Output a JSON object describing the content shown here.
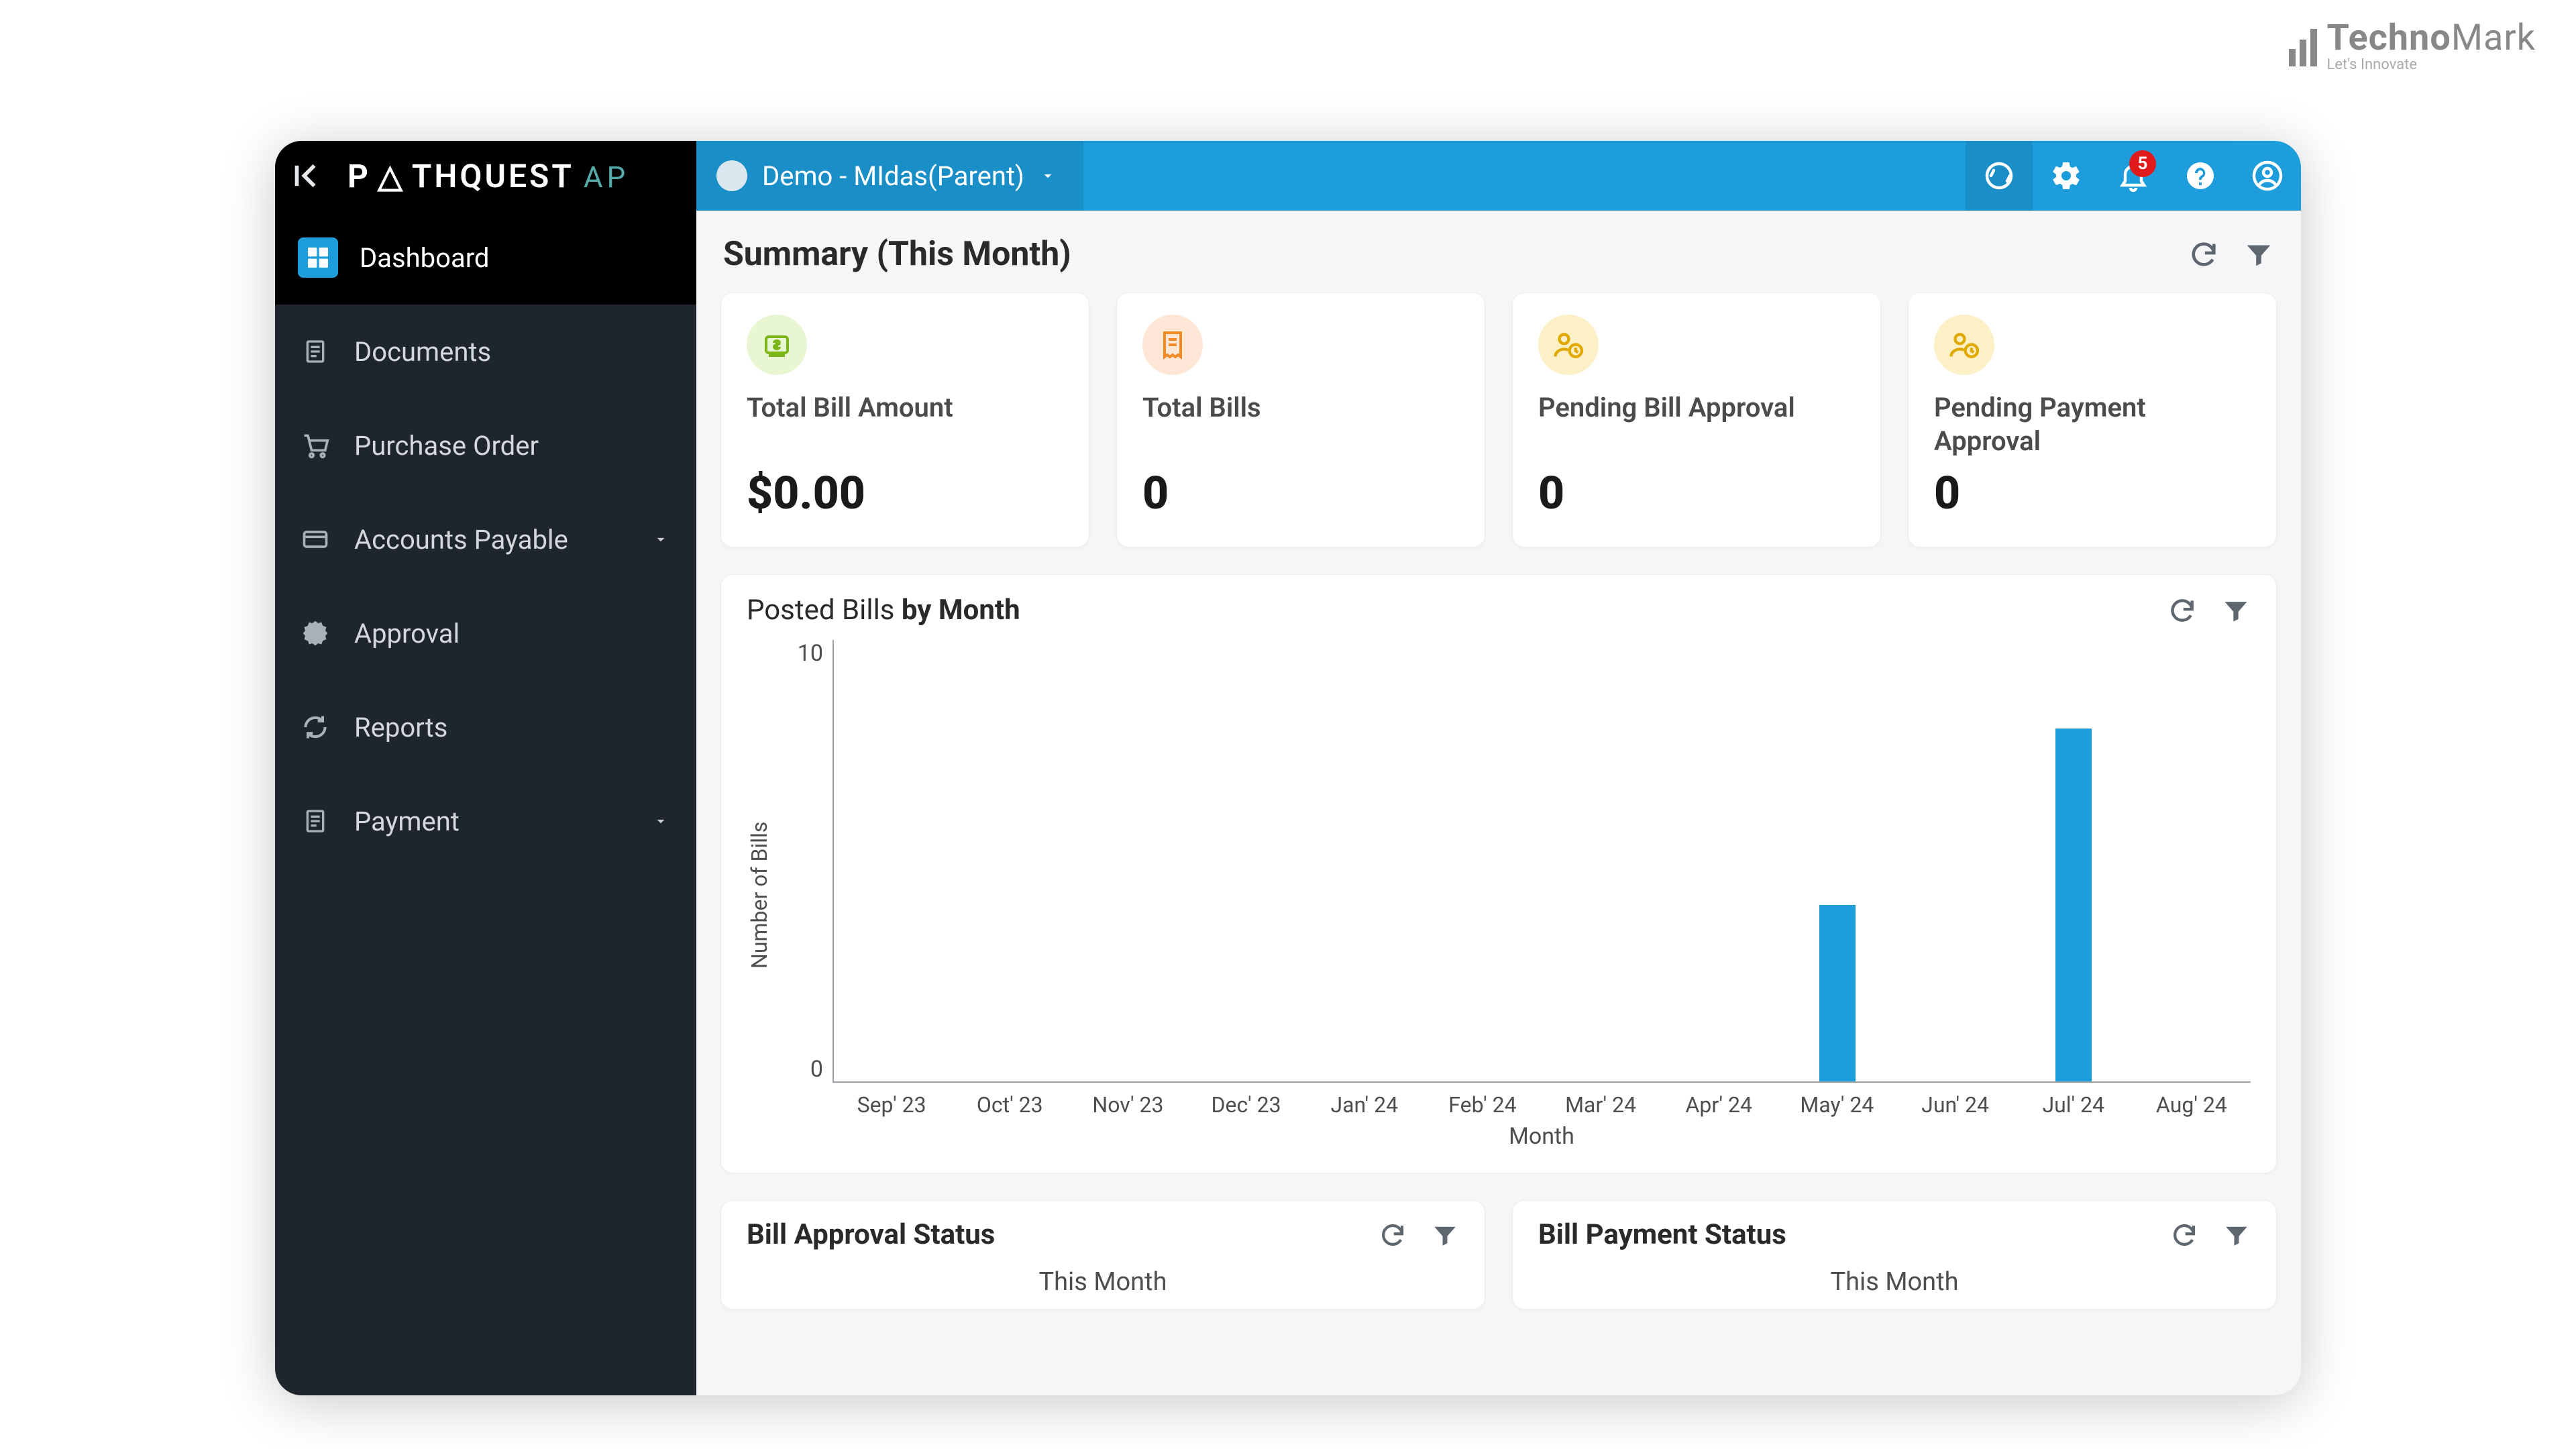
{
  "watermark": {
    "name": "TechnoMark",
    "name_light": "Mark",
    "tagline": "Let's Innovate"
  },
  "brand": {
    "name": "PATHQUEST",
    "suffix": "AP"
  },
  "sidebar": {
    "items": [
      {
        "label": "Dashboard",
        "active": true,
        "icon": "grid-icon",
        "expandable": false
      },
      {
        "label": "Documents",
        "active": false,
        "icon": "document-icon",
        "expandable": false
      },
      {
        "label": "Purchase Order",
        "active": false,
        "icon": "cart-icon",
        "expandable": false
      },
      {
        "label": "Accounts Payable",
        "active": false,
        "icon": "card-icon",
        "expandable": true
      },
      {
        "label": "Approval",
        "active": false,
        "icon": "check-badge-icon",
        "expandable": false
      },
      {
        "label": "Reports",
        "active": false,
        "icon": "cycle-icon",
        "expandable": false
      },
      {
        "label": "Payment",
        "active": false,
        "icon": "document-icon",
        "expandable": true
      }
    ]
  },
  "topbar": {
    "org_name": "Demo - MIdas(Parent)",
    "notification_count": "5"
  },
  "summary": {
    "title": "Summary (This Month)",
    "cards": [
      {
        "label": "Total Bill Amount",
        "value": "$0.00",
        "icon": "money-icon",
        "bg": "#e9f6d2",
        "fg": "#7cb518"
      },
      {
        "label": "Total Bills",
        "value": "0",
        "icon": "receipt-icon",
        "bg": "#ffe6d5",
        "fg": "#f28c28"
      },
      {
        "label": "Pending Bill Approval",
        "value": "0",
        "icon": "person-clock-icon",
        "bg": "#fdf0c6",
        "fg": "#e1a900"
      },
      {
        "label": "Pending Payment Approval",
        "value": "0",
        "icon": "person-clock-icon",
        "bg": "#fdf0c6",
        "fg": "#e1a900"
      }
    ]
  },
  "posted_bills": {
    "title_prefix": "Posted Bills ",
    "title_bold": "by Month"
  },
  "chart_data": {
    "type": "bar",
    "categories": [
      "Sep' 23",
      "Oct' 23",
      "Nov' 23",
      "Dec' 23",
      "Jan' 24",
      "Feb' 24",
      "Mar' 24",
      "Apr' 24",
      "May' 24",
      "Jun' 24",
      "Jul' 24",
      "Aug' 24"
    ],
    "values": [
      0,
      0,
      0,
      0,
      0,
      0,
      0,
      0,
      4,
      0,
      8,
      0
    ],
    "xlabel": "Month",
    "ylabel": "Number of Bills",
    "ylim": [
      0,
      10
    ],
    "yticks": [
      10,
      0
    ],
    "bar_color": "#1e9ddc"
  },
  "status_panels": [
    {
      "title": "Bill Approval Status",
      "period": "This Month"
    },
    {
      "title": "Bill Payment Status",
      "period": "This Month"
    }
  ]
}
